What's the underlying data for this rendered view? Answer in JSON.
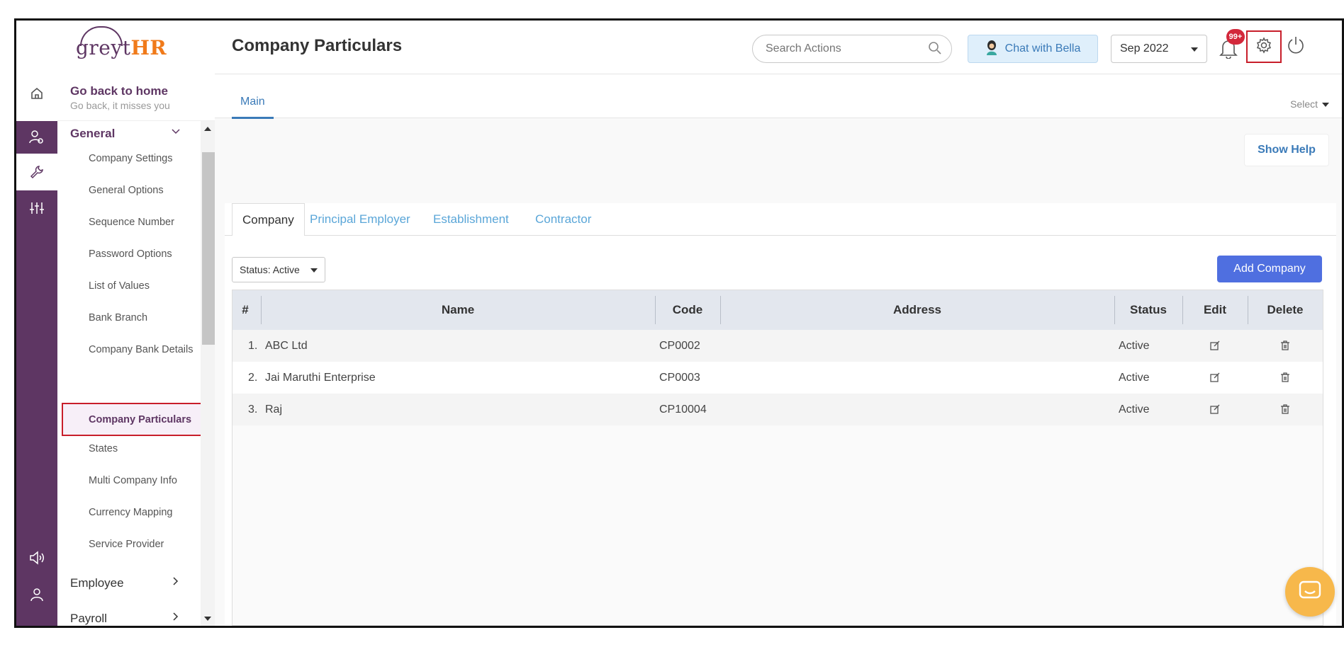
{
  "app": {
    "brand_main": "greyt",
    "brand_hr": "HR"
  },
  "header": {
    "page_title": "Company Particulars",
    "search_placeholder": "Search Actions",
    "chat_label": "Chat with Bella",
    "month": "Sep 2022",
    "notification_badge": "99+"
  },
  "sidebar": {
    "go_home_title": "Go back to home",
    "go_home_subtitle": "Go back, it misses you",
    "general_label": "General",
    "items": [
      "Company Settings",
      "General Options",
      "Sequence Number",
      "Password Options",
      "List of Values",
      "Bank Branch",
      "Company Bank Details",
      "Company Particulars",
      "States",
      "Multi Company Info",
      "Currency Mapping",
      "Service Provider"
    ],
    "active_item": "Company Particulars",
    "employee_label": "Employee",
    "payroll_label": "Payroll"
  },
  "main": {
    "tab_main": "Main",
    "select_label": "Select",
    "show_help": "Show Help",
    "sub_tabs": [
      "Company",
      "Principal Employer",
      "Establishment",
      "Contractor"
    ],
    "status_filter": "Status: Active",
    "add_button": "Add Company",
    "columns": [
      "#",
      "Name",
      "Code",
      "Address",
      "Status",
      "Edit",
      "Delete"
    ],
    "rows": [
      {
        "num": "1.",
        "name": "ABC Ltd",
        "code": "CP0002",
        "address": "",
        "status": "Active"
      },
      {
        "num": "2.",
        "name": "Jai Maruthi Enterprise",
        "code": "CP0003",
        "address": "",
        "status": "Active"
      },
      {
        "num": "3.",
        "name": "Raj",
        "code": "CP10004",
        "address": "",
        "status": "Active"
      }
    ]
  },
  "colors": {
    "brand_purple": "#5e3663",
    "brand_orange": "#f07a1a",
    "accent_blue": "#4f6fe0",
    "link_blue": "#3a7ab8",
    "highlight_red": "#c81e2a"
  }
}
